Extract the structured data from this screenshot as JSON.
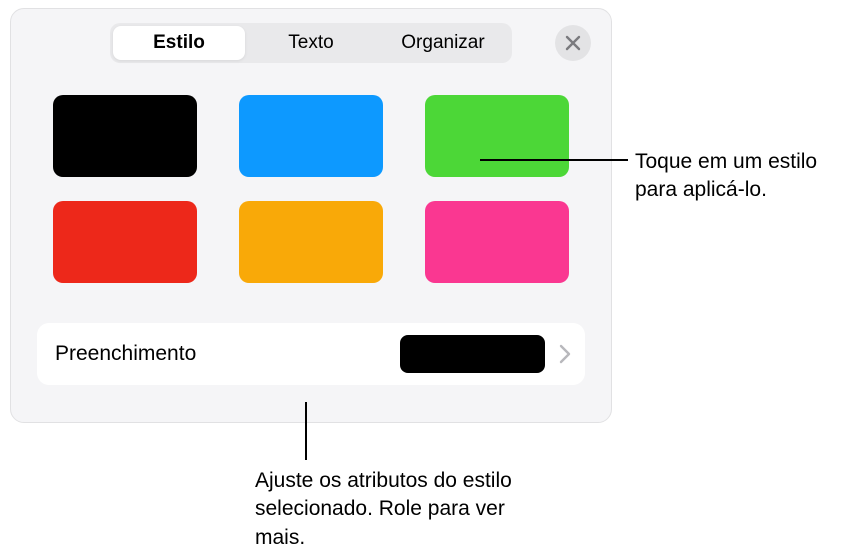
{
  "tabs": {
    "style": "Estilo",
    "text": "Texto",
    "arrange": "Organizar"
  },
  "swatches": [
    {
      "name": "black",
      "color": "#000000"
    },
    {
      "name": "blue",
      "color": "#0d99ff"
    },
    {
      "name": "green",
      "color": "#4cd737"
    },
    {
      "name": "red",
      "color": "#ed281a"
    },
    {
      "name": "orange",
      "color": "#f9a908"
    },
    {
      "name": "pink",
      "color": "#fa3791"
    }
  ],
  "fill": {
    "label": "Preenchimento",
    "preview_color": "#000000"
  },
  "callouts": {
    "apply_style": "Toque em um estilo para aplicá-lo.",
    "adjust_attrs": "Ajuste os atributos do estilo selecionado. Role para ver mais."
  }
}
